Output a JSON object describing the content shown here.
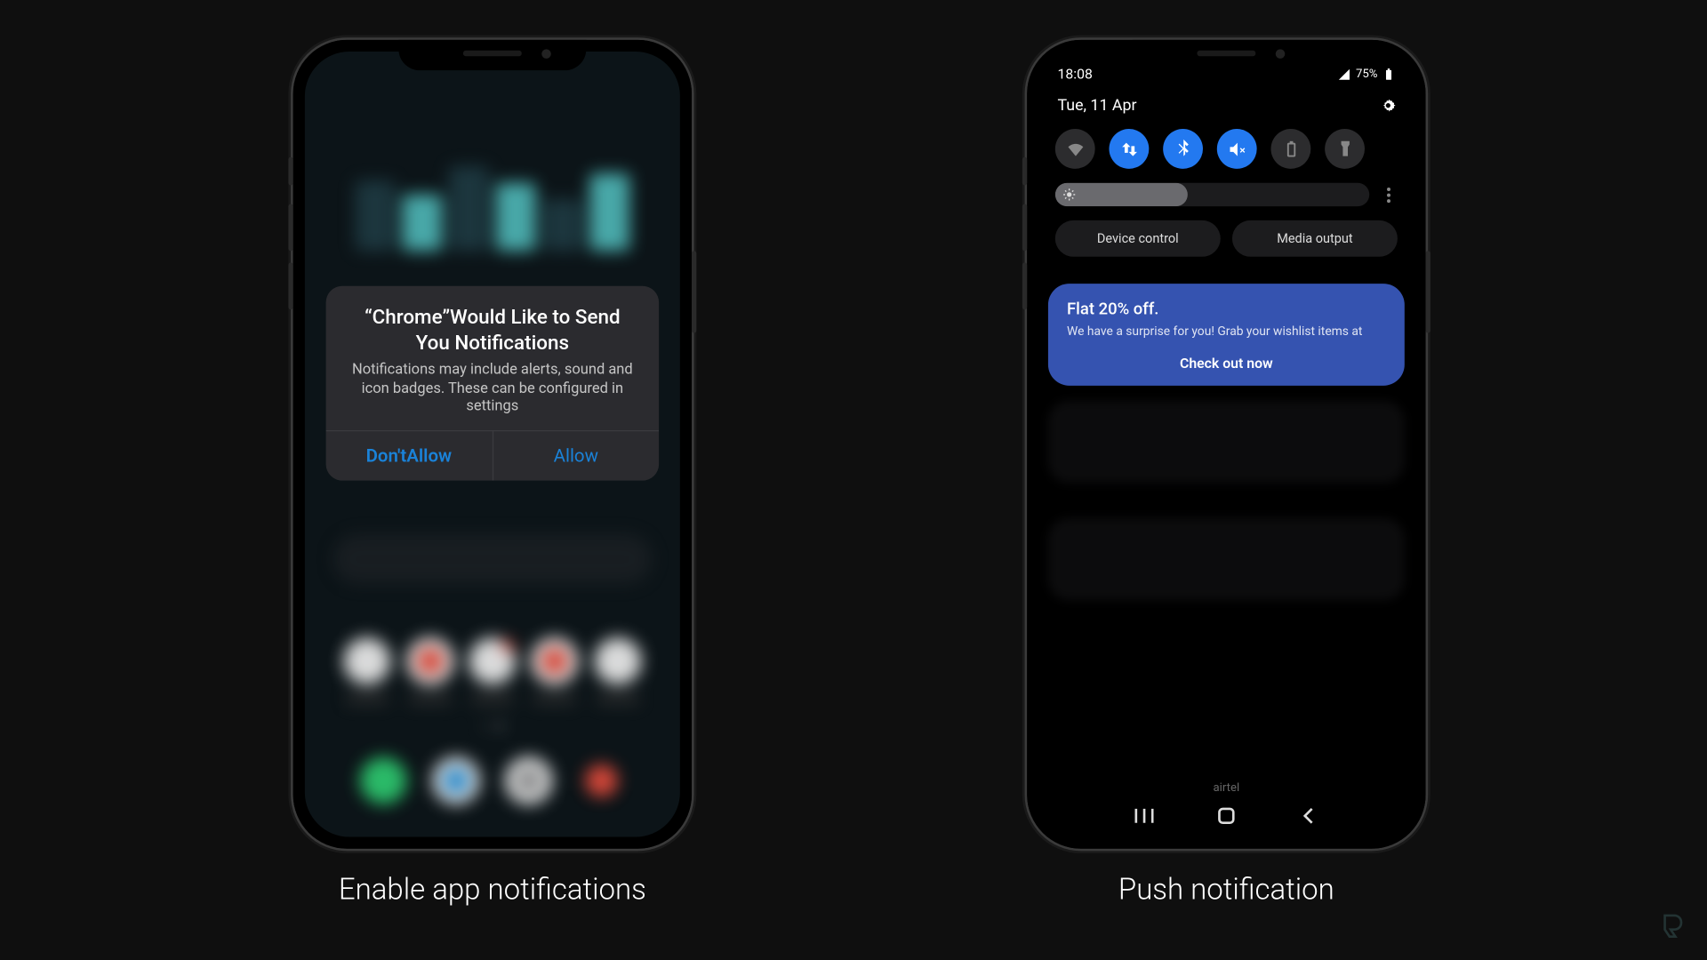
{
  "captions": {
    "left": "Enable app notifications",
    "right": "Push notification"
  },
  "ios_dialog": {
    "title": "“Chrome”Would Like to Send You Notifications",
    "description": "Notifications may include alerts, sound and icon badges. These can be configured in settings",
    "deny": "Don'tAllow",
    "allow": "Allow"
  },
  "android": {
    "time": "18:08",
    "battery": "75%",
    "date": "Tue, 11 Apr",
    "device_control": "Device control",
    "media_output": "Media output",
    "carrier": "airtel"
  },
  "notification": {
    "title": "Flat 20% off.",
    "body": "We have a surprise for you! Grab your wishlist items at",
    "cta": "Check out now"
  }
}
